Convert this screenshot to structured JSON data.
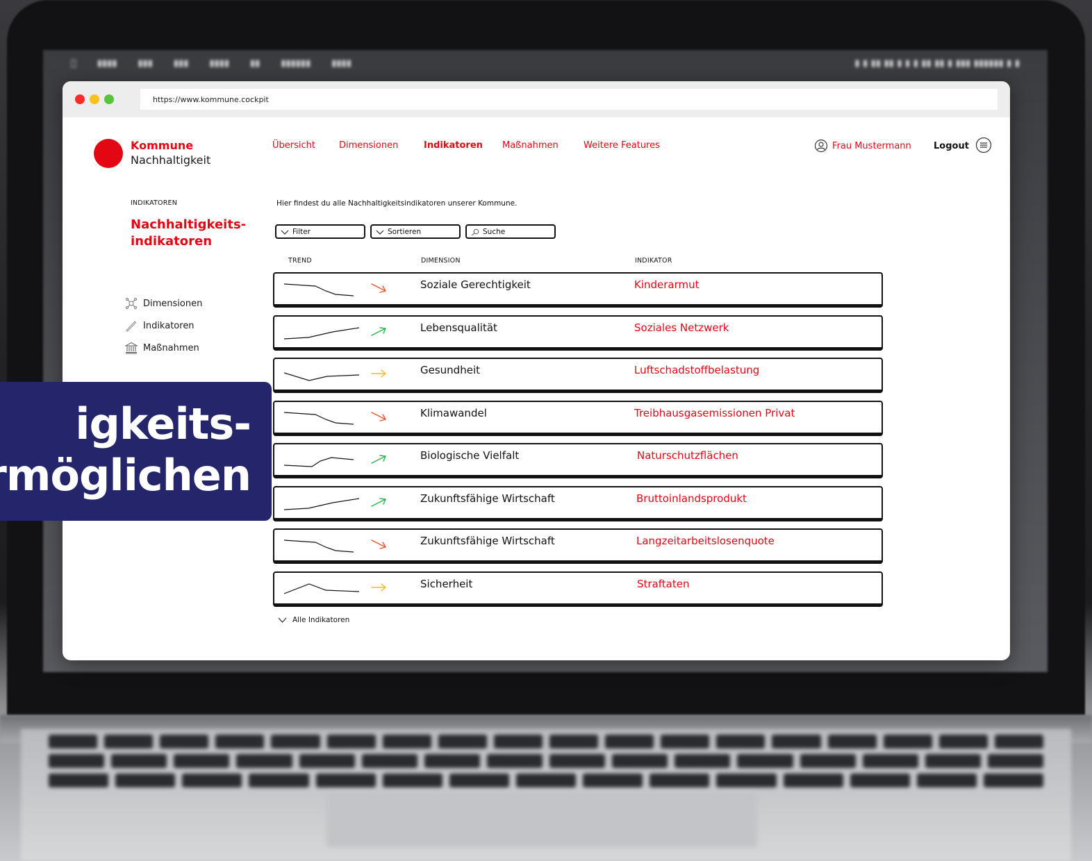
{
  "browser": {
    "url": "https://www.kommune.cockpit"
  },
  "logo": {
    "line1": "Kommune",
    "line2": "Nachhaltigkeit"
  },
  "nav": [
    {
      "label": "Übersicht",
      "active": false
    },
    {
      "label": "Dimensionen",
      "active": false
    },
    {
      "label": "Indikatoren",
      "active": true
    },
    {
      "label": "Maßnahmen",
      "active": false
    },
    {
      "label": "Weitere Features",
      "active": false
    }
  ],
  "user": {
    "name": "Frau Mustermann",
    "logout_label": "Logout"
  },
  "sidebar": {
    "kicker": "INDIKATOREN",
    "title_line1": "Nachhaltigkeits-",
    "title_line2": "indikatoren",
    "items": [
      {
        "label": "Dimensionen",
        "icon": "network-icon"
      },
      {
        "label": "Indikatoren",
        "icon": "pen-icon"
      },
      {
        "label": "Maßnahmen",
        "icon": "building-icon"
      }
    ]
  },
  "main": {
    "intro": "Hier findest du alle Nachhaltigkeitsindikatoren unserer Kommune.",
    "controls": {
      "filter": "Filter",
      "sort": "Sortieren",
      "search": "Suche"
    },
    "columns": {
      "trend": "TREND",
      "dimension": "DIMENSION",
      "indicator": "INDIKATOR"
    },
    "rows": [
      {
        "trend": "down",
        "dimension": "Soziale Gerechtigkeit",
        "indicator": "Kinderarmut"
      },
      {
        "trend": "up",
        "dimension": "Lebensqualität",
        "indicator": "Soziales Netzwerk"
      },
      {
        "trend": "flat",
        "dimension": "Gesundheit",
        "indicator": "Luftschadstoffbelastung"
      },
      {
        "trend": "down",
        "dimension": "Klimawandel",
        "indicator": "Treibhausgasemissionen Privat"
      },
      {
        "trend": "up",
        "dimension": "Biologische Vielfalt",
        "indicator": "Naturschutzflächen"
      },
      {
        "trend": "up",
        "dimension": "Zukunftsfähige Wirtschaft",
        "indicator": "Bruttoinlandsprodukt"
      },
      {
        "trend": "down",
        "dimension": "Zukunftsfähige Wirtschaft",
        "indicator": "Langzeitarbeitslosenquote"
      },
      {
        "trend": "flat",
        "dimension": "Sicherheit",
        "indicator": "Straftaten"
      }
    ],
    "more_label": "Alle Indikatoren"
  },
  "banner": {
    "line1": "igkeits-",
    "line2": "rmöglichen"
  },
  "colors": {
    "brand_red": "#e30613",
    "trend_down": "#f0502a",
    "trend_up": "#2bb24c",
    "trend_flat": "#f5b82a",
    "banner_bg": "#25256b"
  }
}
